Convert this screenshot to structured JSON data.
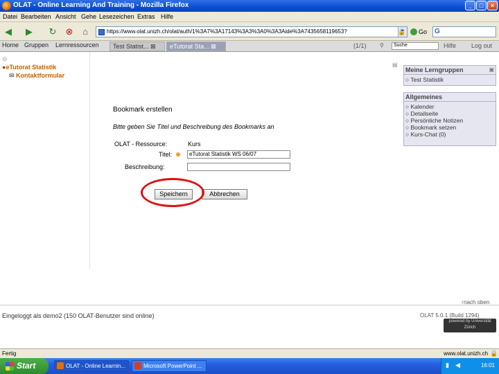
{
  "window": {
    "title": "OLAT - Online Learning And Training - Mozilla Firefox"
  },
  "menu": [
    "Datei",
    "Bearbeiten",
    "Ansicht",
    "Gehe",
    "Lesezeichen",
    "Extras",
    "Hilfe"
  ],
  "address": {
    "url": "https://www.olat.unizh.ch/olat/auth/1%3A7%3A17143%3A3%3A0%3A3Aide%3A7435658119653?",
    "go_label": "Go"
  },
  "olat_nav": {
    "links": [
      "Home",
      "Gruppen",
      "Lernressourcen"
    ],
    "tabs": [
      "Test Statist...",
      "eTutorat Sta..."
    ],
    "pager": "(1/1)",
    "search_placeholder": "Suche",
    "help": "Hilfe",
    "logout": "Log out"
  },
  "tree": {
    "course": "eTutorat Statistik",
    "item": "Kontaktformular"
  },
  "form": {
    "heading": "Bookmark erstellen",
    "intro": "Bitte geben Sie Titel und Beschreibung des Bookmarks an",
    "resource_label": "OLAT - Ressource:",
    "resource_value": "Kurs",
    "title_label": "Titel:",
    "title_value": "eTutorat Statistik WS 06/07",
    "desc_label": "Beschreibung:",
    "desc_value": "",
    "save_label": "Speichern",
    "cancel_label": "Abbrechen"
  },
  "sidebar": {
    "groups": {
      "header": "Meine Lerngruppen",
      "items": [
        "Test Statistik"
      ]
    },
    "general": {
      "header": "Allgemeines",
      "items": [
        "Kalender",
        "Detailseite",
        "Persönliche Notizen",
        "Bookmark setzen",
        "Kurs-Chat (0)"
      ]
    }
  },
  "footer": {
    "login_text": "Eingeloggt als demo2    (150 OLAT-Benutzer sind online)",
    "version": "OLAT 5.0.1 (Build 1294)",
    "top_link": "nach oben",
    "logo_text": "powered by Universität Zürich"
  },
  "statusbar": {
    "text": "Fertig",
    "host": "www.olat.unizh.ch"
  },
  "taskbar": {
    "start": "Start",
    "items": [
      "OLAT - Online Learnin...",
      "Microsoft PowerPoint ..."
    ],
    "clock": "16:01"
  }
}
